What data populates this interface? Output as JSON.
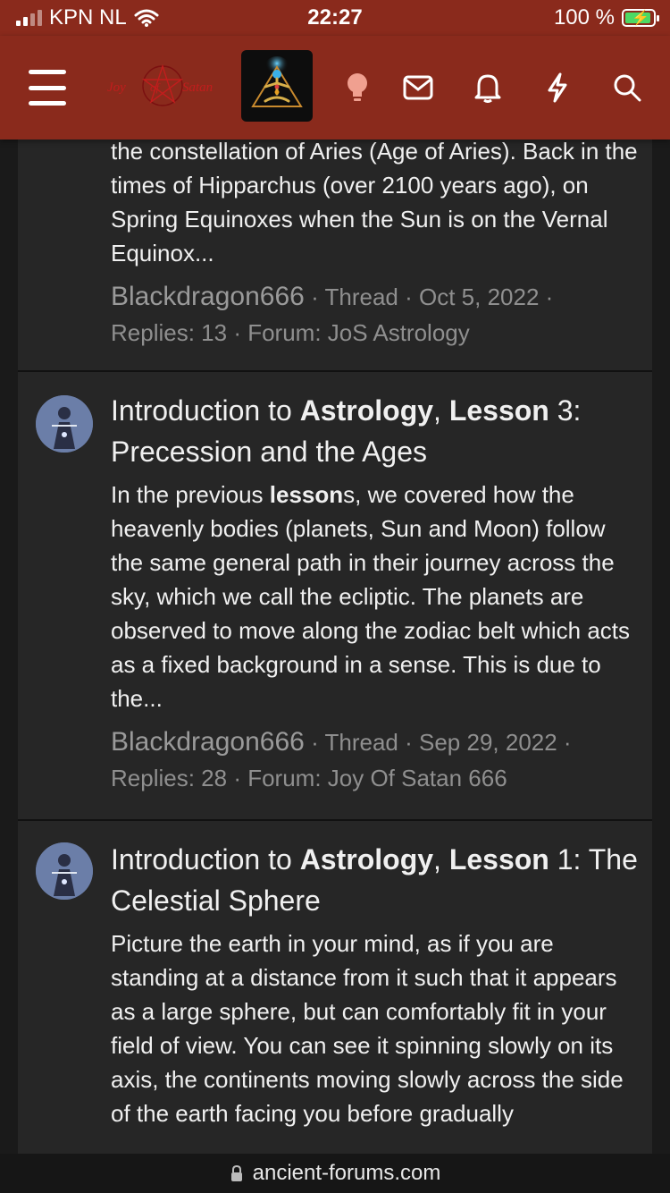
{
  "status_bar": {
    "carrier": "KPN NL",
    "time": "22:27",
    "battery": "100 %"
  },
  "nav": {
    "logo_text": "Joy of Satan",
    "icons": [
      "menu-icon",
      "lightbulb-icon",
      "mail-icon",
      "bell-icon",
      "bolt-icon",
      "search-icon"
    ],
    "accent": "#8a2a1c"
  },
  "results": [
    {
      "snippet": "the constellation of Aries (Age of Aries). Back in the times of Hipparchus (over 2100 years ago), on Spring Equinoxes when the Sun is on the Vernal Equinox...",
      "author": "Blackdragon666",
      "type": "Thread",
      "date": "Oct 5, 2022",
      "replies": "Replies: 13",
      "forum": "Forum: JoS Astrology"
    },
    {
      "title_pre": "Introduction to ",
      "title_b1": "Astrology",
      "title_mid": ", ",
      "title_b2": "Lesson",
      "title_post": " 3: Precession and the Ages",
      "snippet_pre": "In the previous ",
      "snippet_b": "lesson",
      "snippet_post": "s, we covered how the heavenly bodies (planets, Sun and Moon) follow the same general path in their journey across the sky, which we call the ecliptic. The planets are observed to move along the zodiac belt which acts as a fixed background in a sense. This is due to the...",
      "author": "Blackdragon666",
      "type": "Thread",
      "date": "Sep 29, 2022",
      "replies": "Replies: 28",
      "forum": "Forum: Joy Of Satan 666"
    },
    {
      "title_pre": "Introduction to ",
      "title_b1": "Astrology",
      "title_mid": ", ",
      "title_b2": "Lesson",
      "title_post": " 1: The Celestial Sphere",
      "snippet": "Picture the earth in your mind, as if you are standing at a distance from it such that it appears as a large sphere, but can comfortably fit in your field of view. You can see it spinning slowly on its axis, the continents moving slowly across the side of the earth facing you before gradually"
    }
  ],
  "url_bar": {
    "domain": "ancient-forums.com"
  }
}
